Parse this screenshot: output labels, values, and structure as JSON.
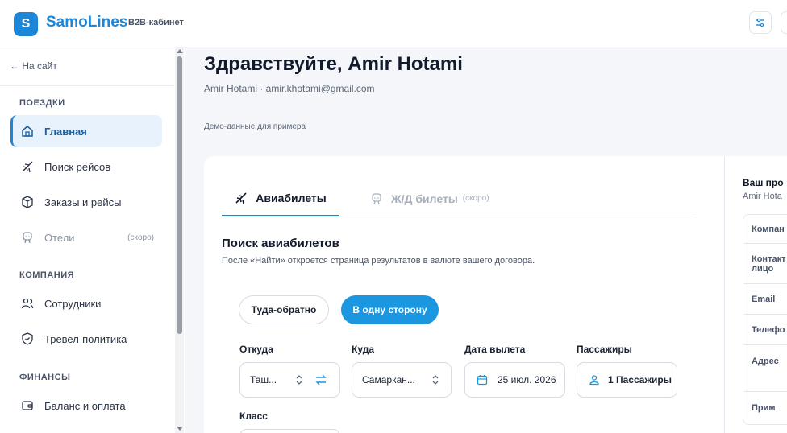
{
  "topbar": {
    "logo_glyph": "S",
    "brand": "SamoLines",
    "brand_sub": "B2B-кабинет"
  },
  "sidebar": {
    "back_link": "← На сайт",
    "sections": {
      "trips": "ПОЕЗДКИ",
      "company": "КОМПАНИЯ",
      "finance": "ФИНАНСЫ"
    },
    "items": [
      {
        "label": "Главная",
        "icon": "home-icon",
        "active": true
      },
      {
        "label": "Поиск рейсов",
        "icon": "plane-icon"
      },
      {
        "label": "Заказы и рейсы",
        "icon": "box-icon"
      },
      {
        "label": "Отели",
        "icon": "hotel-icon",
        "badge": "(скоро)"
      },
      {
        "label": "Сотрудники",
        "icon": "users-icon"
      },
      {
        "label": "Тревел-политика",
        "icon": "shield-icon"
      },
      {
        "label": "Баланс и оплата",
        "icon": "wallet-icon"
      }
    ]
  },
  "main": {
    "greeting": "Здравствуйте, Amir Hotami",
    "user_line": "Amir Hotami · amir.khotami@gmail.com",
    "demo_note": "Демо-данные для примера",
    "tabs": [
      {
        "label": "Авиабилеты",
        "icon": "plane-icon"
      },
      {
        "label": "Ж/Д билеты",
        "icon": "train-icon",
        "badge": "(скоро)"
      }
    ],
    "search": {
      "title": "Поиск авиабилетов",
      "subtitle": "После «Найти» откроется страница результатов в валюте вашего договора.",
      "trip_types": [
        "Туда-обратно",
        "В одну сторону"
      ],
      "fields": {
        "from_label": "Откуда",
        "from_value": "Таш...",
        "to_label": "Куда",
        "to_value": "Самаркан...",
        "date_label": "Дата вылета",
        "date_value": "25 июл. 2026",
        "pax_label": "Пассажиры",
        "pax_value": "1 Пассажиры",
        "class_label": "Класс"
      }
    }
  },
  "profile_panel": {
    "title": "Ваш про",
    "subtitle": "Amir Hota",
    "rows": [
      "Компан",
      "Контакт",
      "лицо",
      "Email",
      "Телефо",
      "Адрес",
      "Прим"
    ]
  },
  "colors": {
    "accent": "#1e86d6",
    "accent_button": "#1a97e0",
    "active_bg": "#e7f2fc"
  }
}
